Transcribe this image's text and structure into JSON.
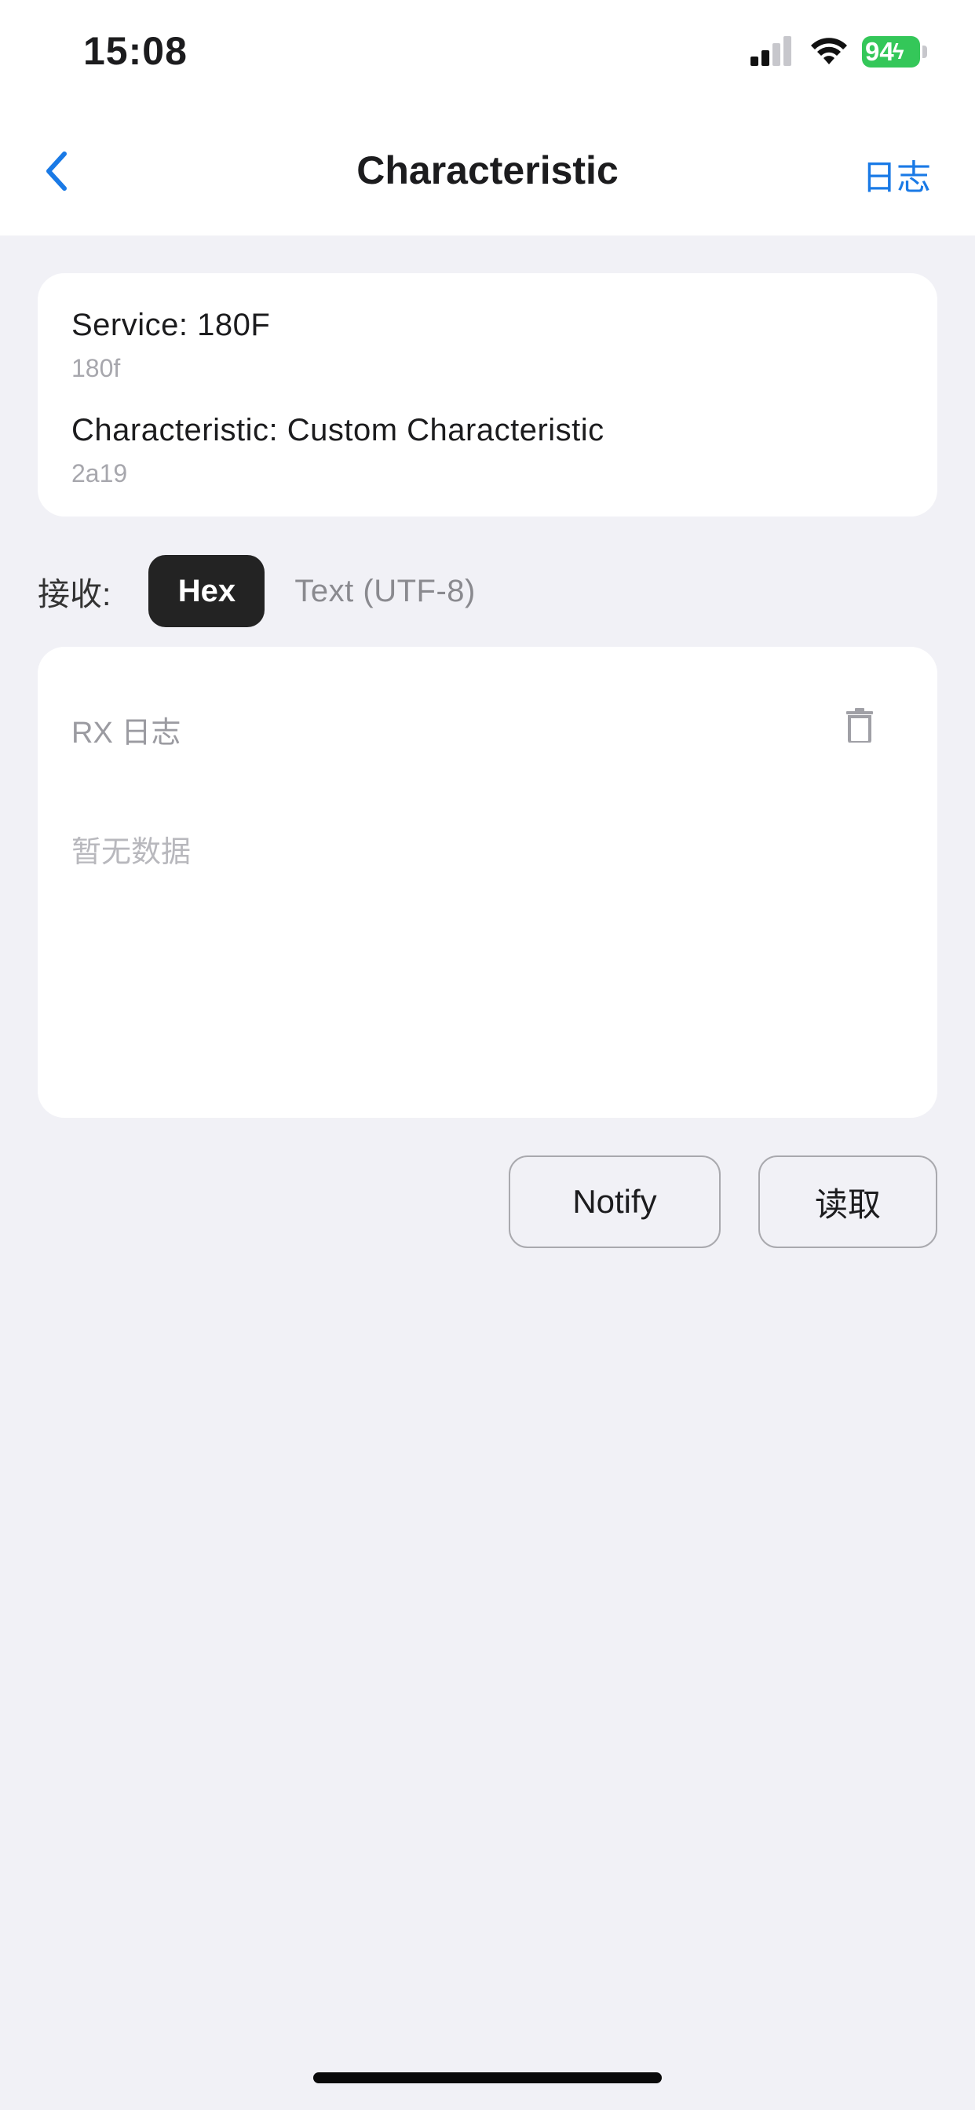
{
  "status_bar": {
    "time": "15:08",
    "battery_percent": "94",
    "battery_color": "#34c759",
    "icons": [
      "signal-icon",
      "wifi-icon",
      "battery-charging-icon"
    ]
  },
  "nav": {
    "title": "Characteristic",
    "right_action": "日志",
    "accent_color": "#1a7ae6"
  },
  "info": {
    "service_label": "Service: 180F",
    "service_uuid": "180f",
    "characteristic_label": "Characteristic: Custom Characteristic",
    "characteristic_uuid": "2a19"
  },
  "receive": {
    "label": "接收:",
    "mode_hex": "Hex",
    "mode_text": "Text (UTF-8)",
    "selected": "Hex"
  },
  "rx_log": {
    "title": "RX 日志",
    "empty_text": "暂无数据"
  },
  "actions": {
    "notify_label": "Notify",
    "read_label": "读取"
  }
}
